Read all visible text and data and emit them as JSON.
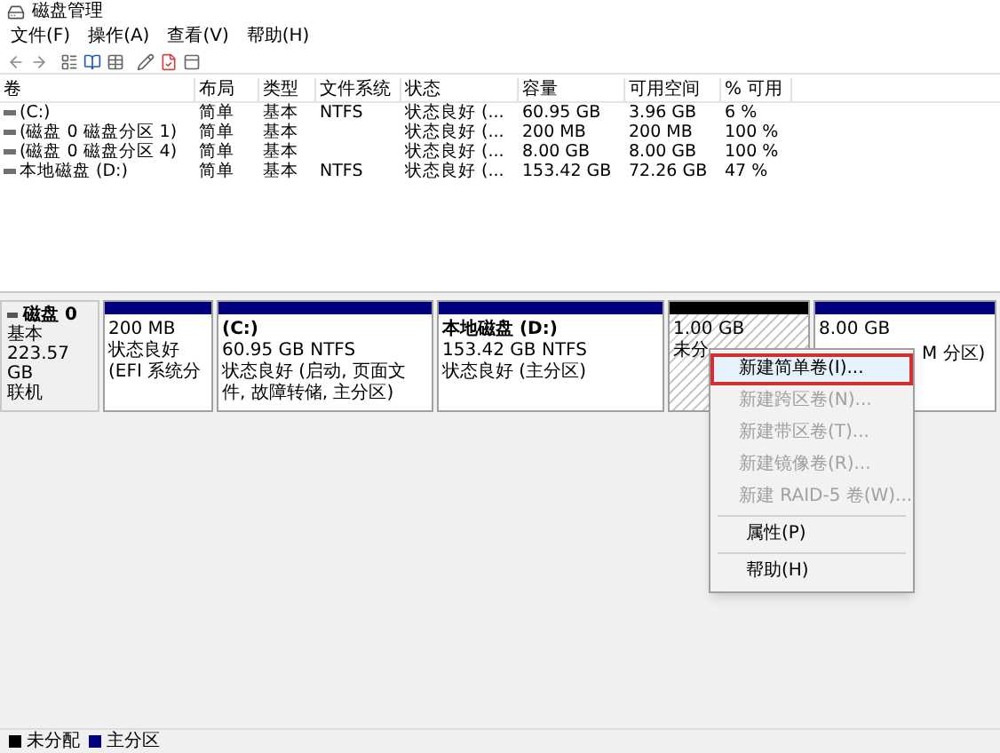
{
  "window": {
    "title": "磁盘管理"
  },
  "menu": [
    "文件(F)",
    "操作(A)",
    "查看(V)",
    "帮助(H)"
  ],
  "volume_table": {
    "columns": [
      "卷",
      "布局",
      "类型",
      "文件系统",
      "状态",
      "容量",
      "可用空间",
      "% 可用"
    ],
    "rows": [
      [
        "(C:)",
        "简单",
        "基本",
        "NTFS",
        "状态良好 (...",
        "60.95 GB",
        "3.96 GB",
        "6 %"
      ],
      [
        "(磁盘 0 磁盘分区 1)",
        "简单",
        "基本",
        "",
        "状态良好 (...",
        "200 MB",
        "200 MB",
        "100 %"
      ],
      [
        "(磁盘 0 磁盘分区 4)",
        "简单",
        "基本",
        "",
        "状态良好 (...",
        "8.00 GB",
        "8.00 GB",
        "100 %"
      ],
      [
        "本地磁盘 (D:)",
        "简单",
        "基本",
        "NTFS",
        "状态良好 (...",
        "153.42 GB",
        "72.26 GB",
        "47 %"
      ]
    ]
  },
  "disks": [
    {
      "name": "磁盘 0",
      "type": "基本",
      "size": "223.57 GB",
      "status": "联机",
      "partitions": [
        {
          "kind": "primary",
          "size": "200 MB",
          "status": "状态良好 (EFI 系统分"
        },
        {
          "kind": "primary",
          "name": "(C:)",
          "size": "60.95 GB NTFS",
          "status": "状态良好 (启动, 页面文件, 故障转储, 主分区)"
        },
        {
          "kind": "primary",
          "name": "本地磁盘 (D:)",
          "size": "153.42 GB NTFS",
          "status": "状态良好 (主分区)"
        },
        {
          "kind": "unallocated",
          "size": "1.00 GB",
          "status": "未分"
        },
        {
          "kind": "primary",
          "size": "8.00 GB",
          "status": "M 分区)"
        }
      ]
    }
  ],
  "context_menu": {
    "groups": [
      [
        {
          "label": "新建简单卷(I)...",
          "disabled": false,
          "selected": true
        },
        {
          "label": "新建跨区卷(N)...",
          "disabled": true,
          "selected": false
        },
        {
          "label": "新建带区卷(T)...",
          "disabled": true,
          "selected": false
        },
        {
          "label": "新建镜像卷(R)...",
          "disabled": true,
          "selected": false
        },
        {
          "label": "新建 RAID-5 卷(W)...",
          "disabled": true,
          "selected": false
        }
      ],
      [
        {
          "label": "属性(P)",
          "disabled": false,
          "selected": false
        }
      ],
      [
        {
          "label": "帮助(H)",
          "disabled": false,
          "selected": false
        }
      ]
    ]
  },
  "legend": [
    {
      "label": "未分配",
      "color": "#000000"
    },
    {
      "label": "主分区",
      "color": "#00007f"
    }
  ]
}
